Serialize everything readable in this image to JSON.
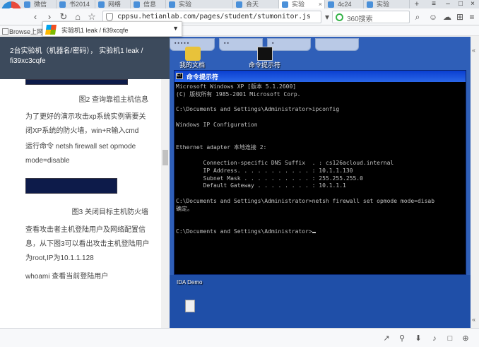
{
  "browser": {
    "tabs": [
      {
        "label": "微信"
      },
      {
        "label": "书2014"
      },
      {
        "label": "网络"
      },
      {
        "label": "信息"
      },
      {
        "label": "实验"
      },
      {
        "label": "合天"
      },
      {
        "label": "实验",
        "active": true
      },
      {
        "label": "4c24"
      },
      {
        "label": "实验"
      }
    ],
    "new_tab": "+",
    "url": "cppsu.hetianlab.com/pages/student/stumonitor.js",
    "search_placeholder": "360搜索",
    "bookmark": "Browse上网啦"
  },
  "left": {
    "header_text": "2台实验机（机器名/密码）， 实验机1  leak / fi39xc3cqfe",
    "vm_selector": "实验机1    leak / fi39xcqfe",
    "caption2": "图2 查询靠祖主机信息",
    "para1": "为了更好的演示攻击xp系统实例需要关闭XP系统的防火墙，win+R输入cmd",
    "para2": "运行命令 netsh firewall set opmode mode=disable",
    "caption3": "图3 关闭目标主机防火墙",
    "para3": "查看攻击者主机登陆用户及网络配置信息，从下图3可以看出攻击主机登陆用户为root,IP为10.1.1.128",
    "para4": "whoami  查看当前登陆用户"
  },
  "vm": {
    "desktop_label_1": "我的文档",
    "desktop_label_2": "命令提示符",
    "desktop_label_3": "IDA Demo",
    "cmd_title": "命令提示符",
    "console_lines": [
      "Microsoft Windows XP [版本 5.1.2600]",
      "(C) 版权所有 1985-2001 Microsoft Corp.",
      "",
      "C:\\Documents and Settings\\Administrator>ipconfig",
      "",
      "Windows IP Configuration",
      "",
      "",
      "Ethernet adapter 本地连接 2:",
      "",
      "        Connection-specific DNS Suffix  . : cs126acloud.internal",
      "        IP Address. . . . . . . . . . . : 10.1.1.130",
      "        Subnet Mask . . . . . . . . . . : 255.255.255.0",
      "        Default Gateway . . . . . . . . : 10.1.1.1",
      "",
      "C:\\Documents and Settings\\Administrator>netsh firewall set opmode mode=disab",
      "确定。",
      "",
      "",
      "C:\\Documents and Settings\\Administrator>"
    ]
  },
  "colors": {
    "accent": "#2f5fb8",
    "cmd_bg": "#000000",
    "cmd_text": "#c0c0c0"
  }
}
